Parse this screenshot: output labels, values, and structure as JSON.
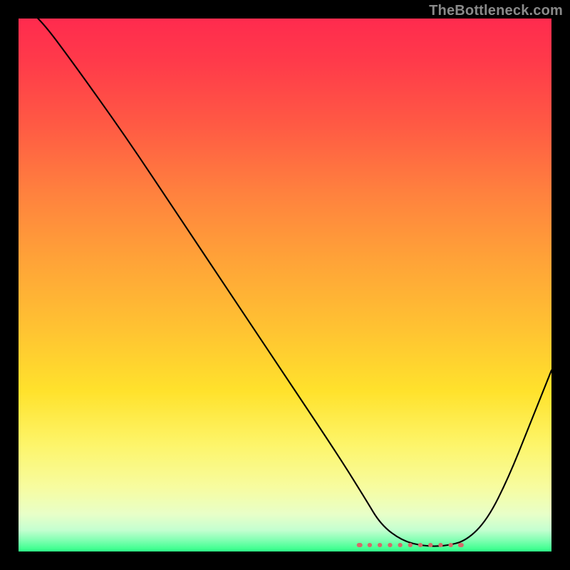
{
  "watermark": "TheBottleneck.com",
  "chart_data": {
    "type": "line",
    "title": "",
    "xlabel": "",
    "ylabel": "",
    "xlim": [
      0,
      100
    ],
    "ylim": [
      0,
      100
    ],
    "grid": false,
    "legend": false,
    "series": [
      {
        "name": "bottleneck-curve",
        "x": [
          0,
          4,
          10,
          20,
          30,
          40,
          50,
          60,
          65,
          68,
          72,
          76,
          80,
          84,
          88,
          92,
          96,
          100
        ],
        "values": [
          103,
          100,
          92,
          78,
          63,
          48,
          33,
          18,
          10,
          5,
          2,
          1,
          1,
          2,
          6,
          14,
          24,
          34
        ]
      }
    ],
    "flat_region": {
      "x_range": [
        64,
        83
      ],
      "y": 1.2,
      "color": "#d46a6a"
    },
    "background_gradient": [
      {
        "pos": 0,
        "color": "#ff2b4e"
      },
      {
        "pos": 50,
        "color": "#ffb236"
      },
      {
        "pos": 80,
        "color": "#fdf56a"
      },
      {
        "pos": 100,
        "color": "#2eff87"
      }
    ]
  }
}
